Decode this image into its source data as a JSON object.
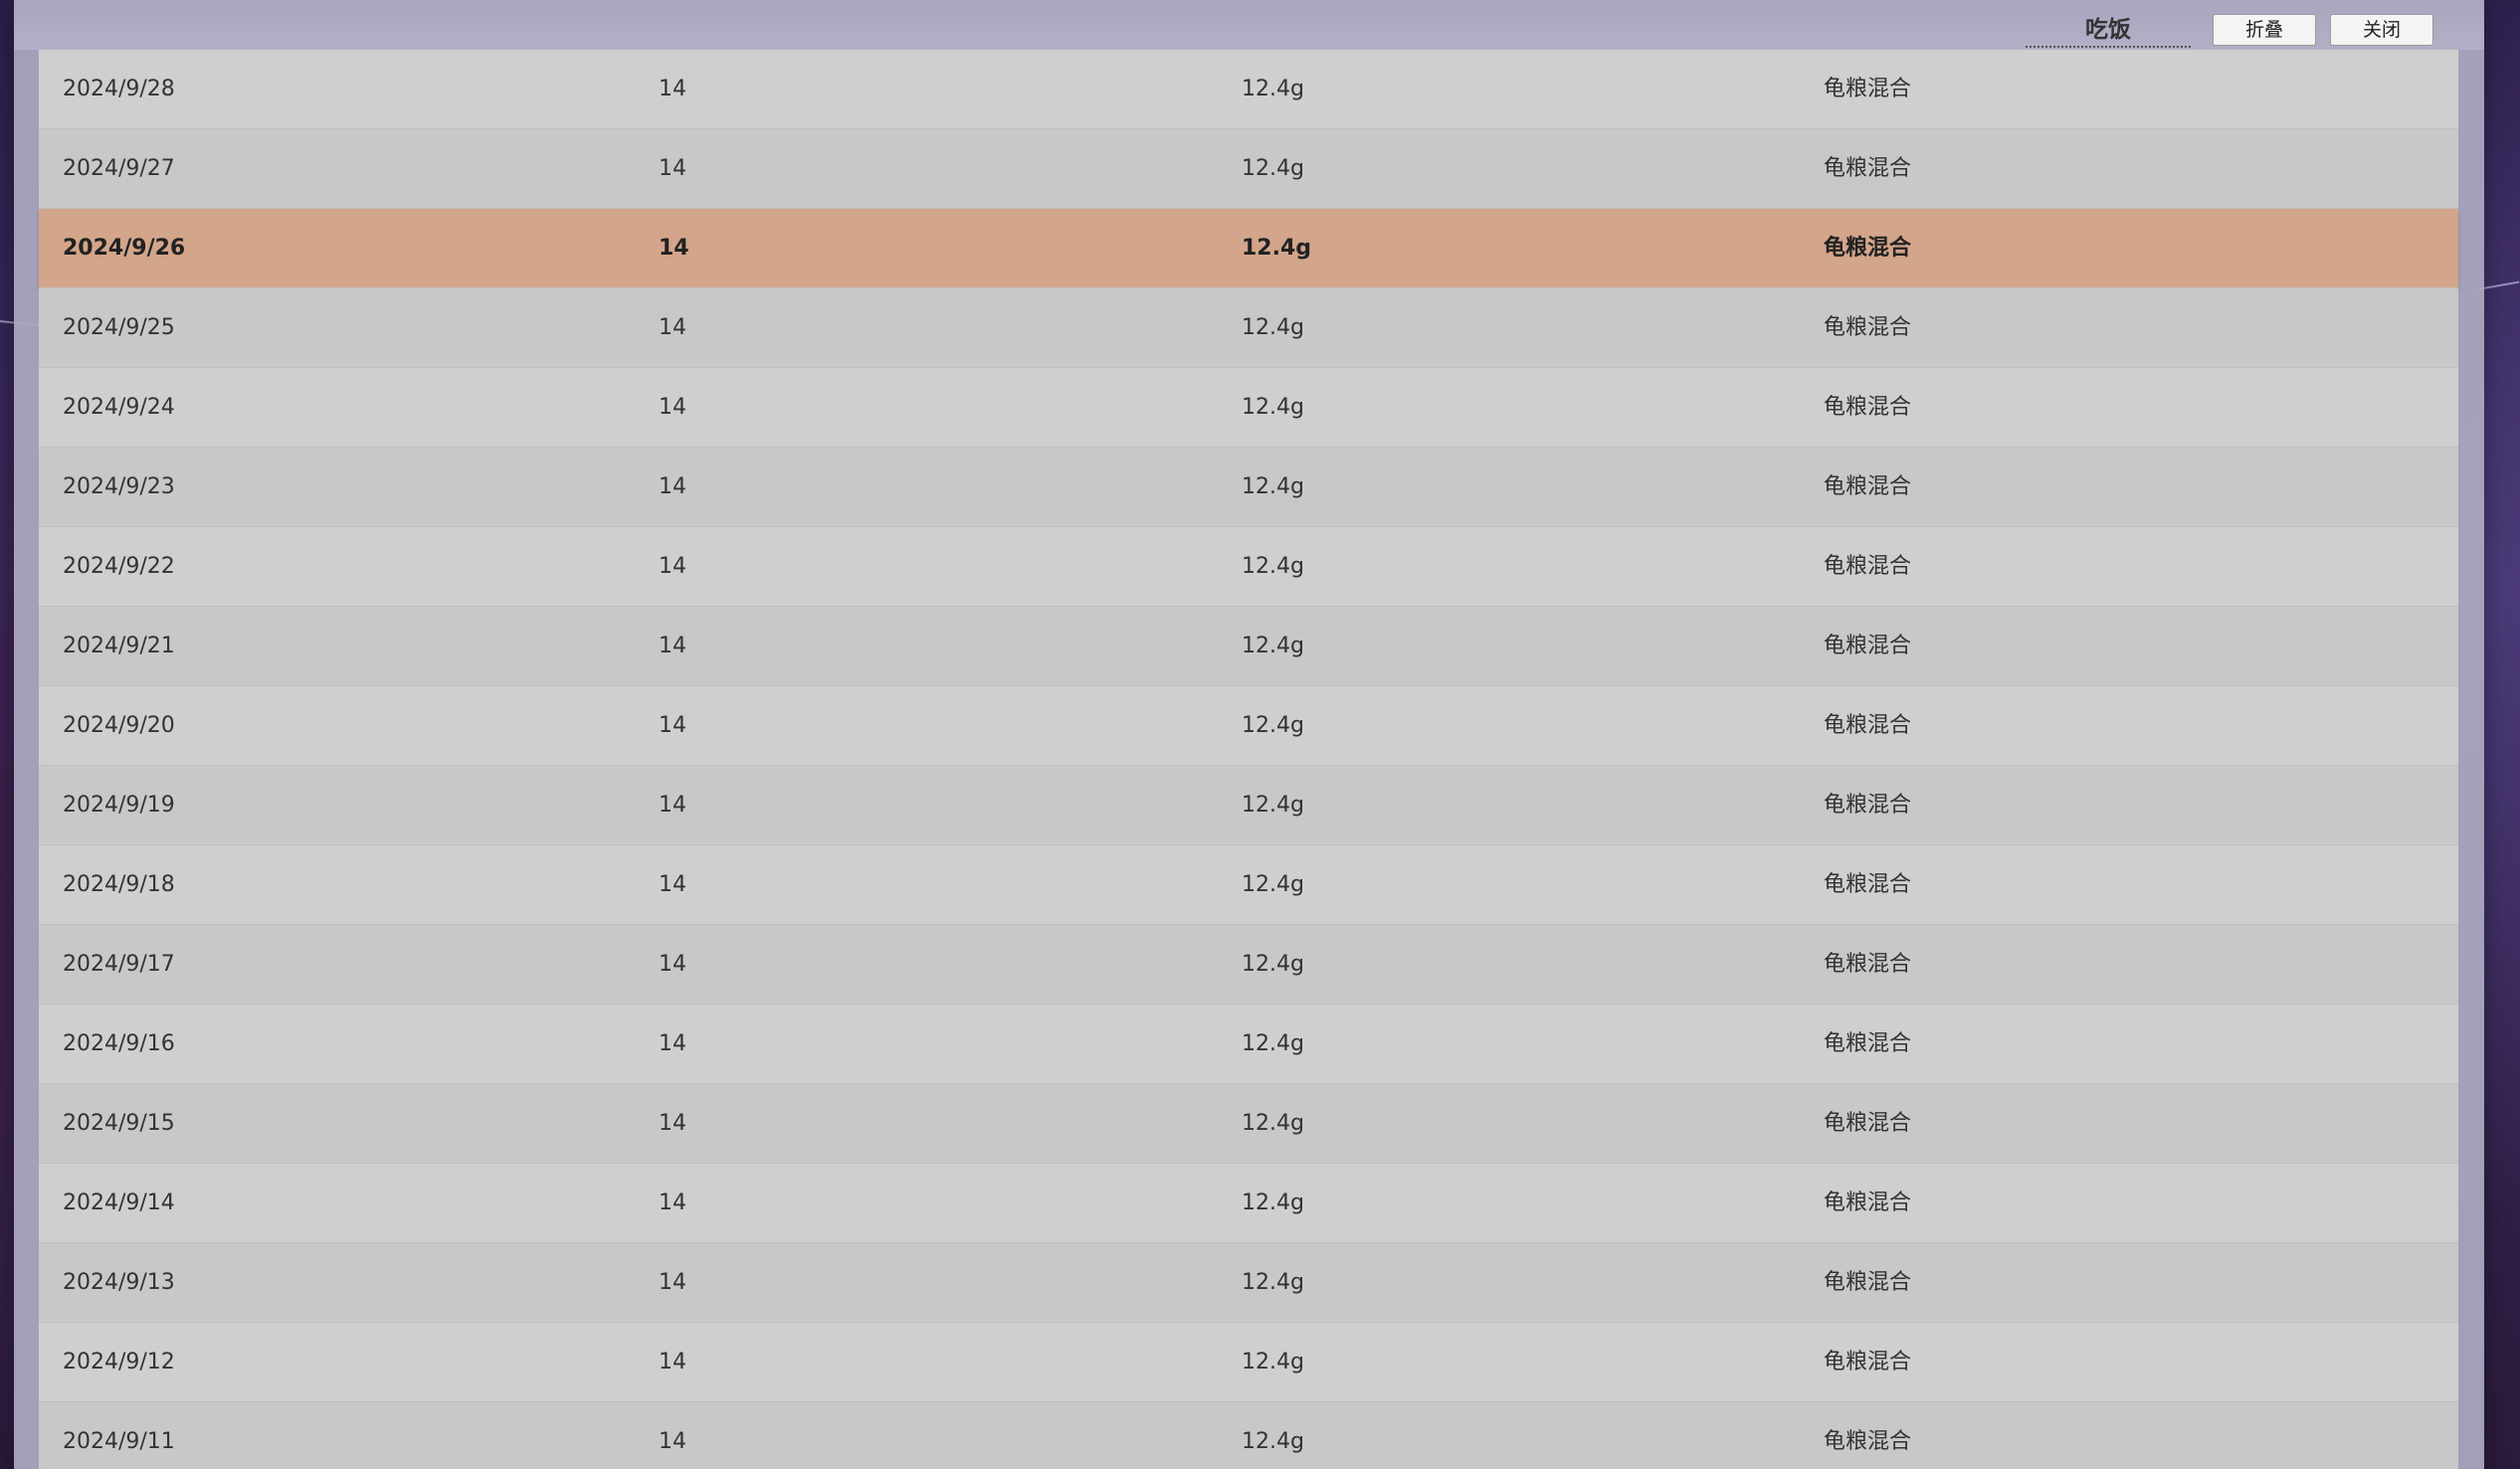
{
  "window": {
    "title": "吃饭",
    "fold_label": "折叠",
    "close_label": "关闭"
  },
  "table": {
    "selected_index": 2,
    "rows": [
      {
        "date": "2024/9/28",
        "count": "14",
        "weight": "12.4g",
        "food": "龟粮混合"
      },
      {
        "date": "2024/9/27",
        "count": "14",
        "weight": "12.4g",
        "food": "龟粮混合"
      },
      {
        "date": "2024/9/26",
        "count": "14",
        "weight": "12.4g",
        "food": "龟粮混合"
      },
      {
        "date": "2024/9/25",
        "count": "14",
        "weight": "12.4g",
        "food": "龟粮混合"
      },
      {
        "date": "2024/9/24",
        "count": "14",
        "weight": "12.4g",
        "food": "龟粮混合"
      },
      {
        "date": "2024/9/23",
        "count": "14",
        "weight": "12.4g",
        "food": "龟粮混合"
      },
      {
        "date": "2024/9/22",
        "count": "14",
        "weight": "12.4g",
        "food": "龟粮混合"
      },
      {
        "date": "2024/9/21",
        "count": "14",
        "weight": "12.4g",
        "food": "龟粮混合"
      },
      {
        "date": "2024/9/20",
        "count": "14",
        "weight": "12.4g",
        "food": "龟粮混合"
      },
      {
        "date": "2024/9/19",
        "count": "14",
        "weight": "12.4g",
        "food": "龟粮混合"
      },
      {
        "date": "2024/9/18",
        "count": "14",
        "weight": "12.4g",
        "food": "龟粮混合"
      },
      {
        "date": "2024/9/17",
        "count": "14",
        "weight": "12.4g",
        "food": "龟粮混合"
      },
      {
        "date": "2024/9/16",
        "count": "14",
        "weight": "12.4g",
        "food": "龟粮混合"
      },
      {
        "date": "2024/9/15",
        "count": "14",
        "weight": "12.4g",
        "food": "龟粮混合"
      },
      {
        "date": "2024/9/14",
        "count": "14",
        "weight": "12.4g",
        "food": "龟粮混合"
      },
      {
        "date": "2024/9/13",
        "count": "14",
        "weight": "12.4g",
        "food": "龟粮混合"
      },
      {
        "date": "2024/9/12",
        "count": "14",
        "weight": "12.4g",
        "food": "龟粮混合"
      },
      {
        "date": "2024/9/11",
        "count": "14",
        "weight": "12.4g",
        "food": "龟粮混合"
      }
    ]
  },
  "colors": {
    "selected_row": "#d3a58a",
    "row_light": "#cfcfcf",
    "row_dark": "#c8c8c8"
  }
}
